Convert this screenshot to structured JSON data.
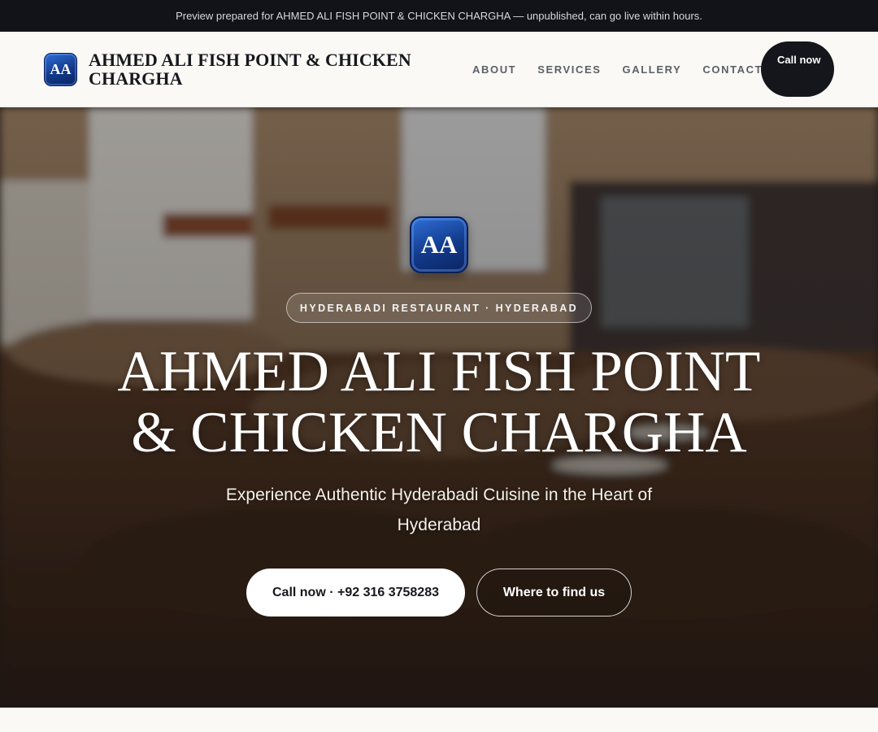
{
  "topbar": {
    "text": "Preview prepared for AHMED ALI FISH POINT & CHICKEN CHARGHA — unpublished, can go live within hours."
  },
  "header": {
    "logo_text": "AA",
    "brand_name": "AHMED ALI FISH POINT & CHICKEN CHARGHA",
    "nav": [
      "ABOUT",
      "SERVICES",
      "GALLERY",
      "CONTACT"
    ],
    "call_label": "Call now"
  },
  "hero": {
    "logo_text": "AA",
    "tagline": "HYDERABADI RESTAURANT · HYDERABAD",
    "title_line1": "AHMED ALI FISH POINT",
    "title_line2": "& CHICKEN CHARGHA",
    "subtitle": "Experience Authentic Hyderabadi Cuisine in the Heart of Hyderabad",
    "primary_button": "Call now · +92 316 3758283",
    "secondary_button": "Where to find us"
  },
  "colors": {
    "dark": "#111318",
    "logo_blue": "#123a8a",
    "page_bg": "#faf9f6"
  }
}
